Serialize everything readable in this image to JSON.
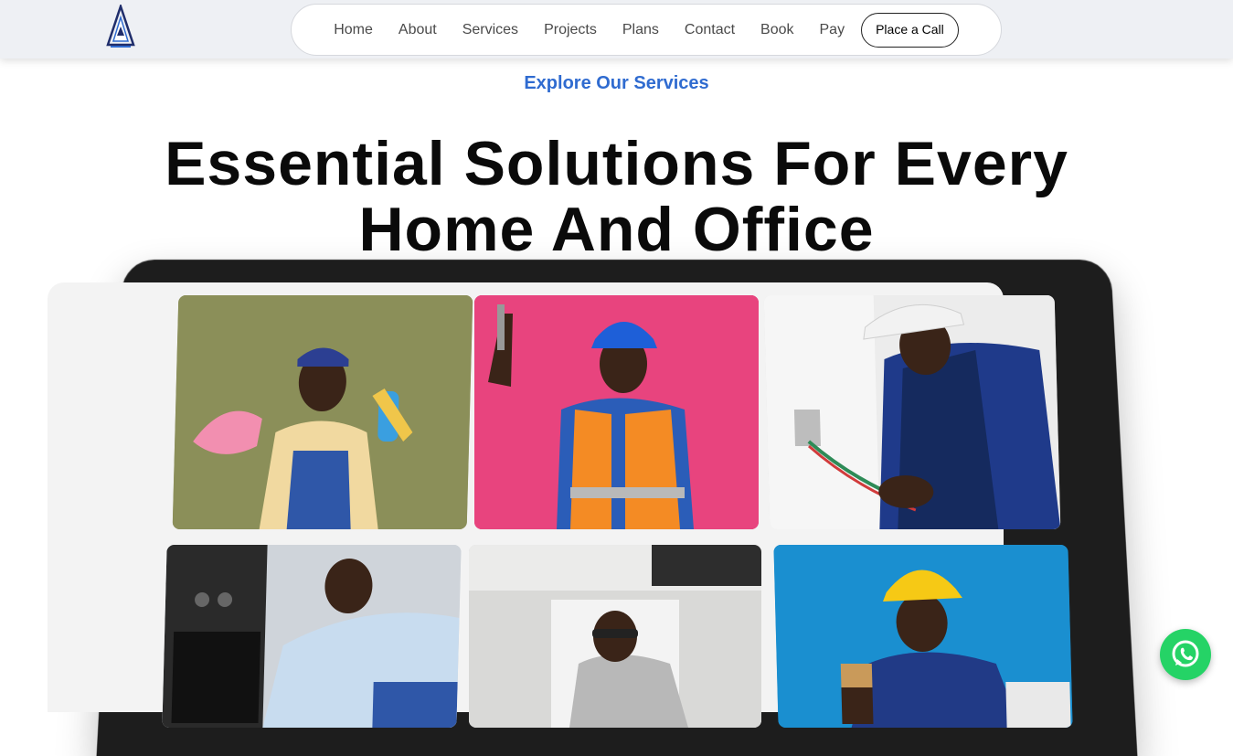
{
  "header": {
    "logo_icon": "logo-a-triangle-icon",
    "nav": {
      "items": [
        {
          "label": "Home"
        },
        {
          "label": "About"
        },
        {
          "label": "Services"
        },
        {
          "label": "Projects"
        },
        {
          "label": "Plans"
        },
        {
          "label": "Contact"
        },
        {
          "label": "Book"
        },
        {
          "label": "Pay"
        }
      ],
      "cta_label": "Place a Call"
    }
  },
  "hero": {
    "eyebrow": "Explore Our Services",
    "headline": "Essential Solutions For Every Home And Office"
  },
  "services_gallery": {
    "images": [
      {
        "subject": "cleaner-photo"
      },
      {
        "subject": "construction-worker-photo"
      },
      {
        "subject": "electrician-photo"
      },
      {
        "subject": "appliance-repair-photo"
      },
      {
        "subject": "plumber-photo"
      },
      {
        "subject": "painter-photo"
      }
    ]
  },
  "chat_widget": {
    "icon": "whatsapp-icon"
  },
  "colors": {
    "accent": "#2f6bd0",
    "whatsapp": "#25d366",
    "header_bg": "#eef0f4"
  }
}
